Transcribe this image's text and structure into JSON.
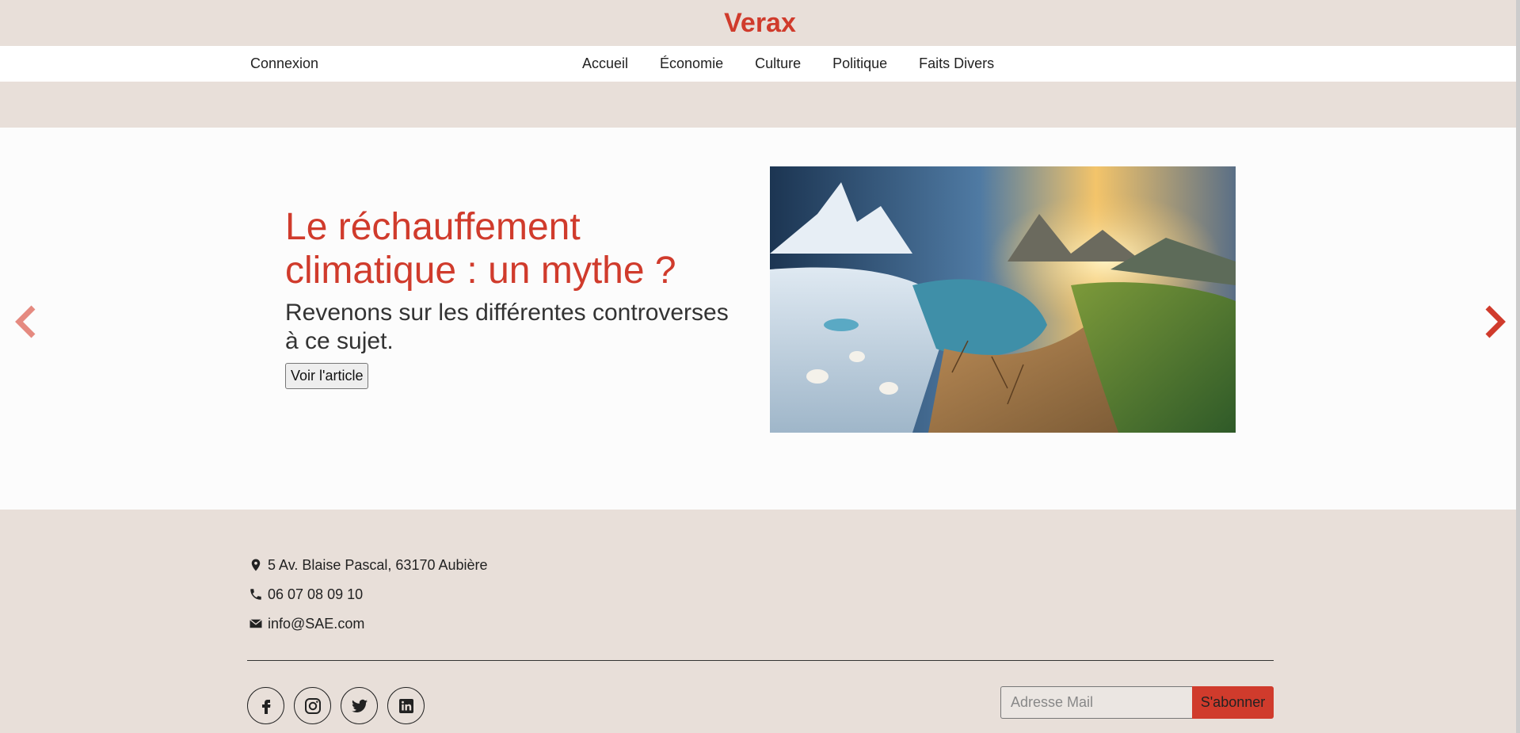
{
  "brand": {
    "name": "Verax",
    "color": "#d03b2c"
  },
  "nav": {
    "login_label": "Connexion",
    "items": [
      {
        "label": "Accueil"
      },
      {
        "label": "Économie"
      },
      {
        "label": "Culture"
      },
      {
        "label": "Politique"
      },
      {
        "label": "Faits Divers"
      }
    ]
  },
  "carousel": {
    "prev_icon": "chevron-left-icon",
    "next_icon": "chevron-right-icon",
    "slide": {
      "title": "Le réchauffement climatique : un mythe ?",
      "subtitle": "Revenons sur les différentes controverses à ce sujet.",
      "button_label": "Voir l'article",
      "image": "climate-illustration-polar-bears-glacier-desert"
    }
  },
  "footer": {
    "address": "5 Av. Blaise Pascal, 63170 Aubière",
    "phone": "06 07 08 09 10",
    "email": "info@SAE.com",
    "socials": [
      {
        "icon": "facebook-icon"
      },
      {
        "icon": "instagram-icon"
      },
      {
        "icon": "twitter-icon"
      },
      {
        "icon": "linkedin-icon"
      }
    ],
    "subscribe": {
      "placeholder": "Adresse Mail",
      "value": "",
      "button_label": "S'abonner"
    }
  },
  "colors": {
    "background": "#e8dfd9",
    "accent": "#d03b2c",
    "carousel_bg": "#fcfcfc"
  }
}
